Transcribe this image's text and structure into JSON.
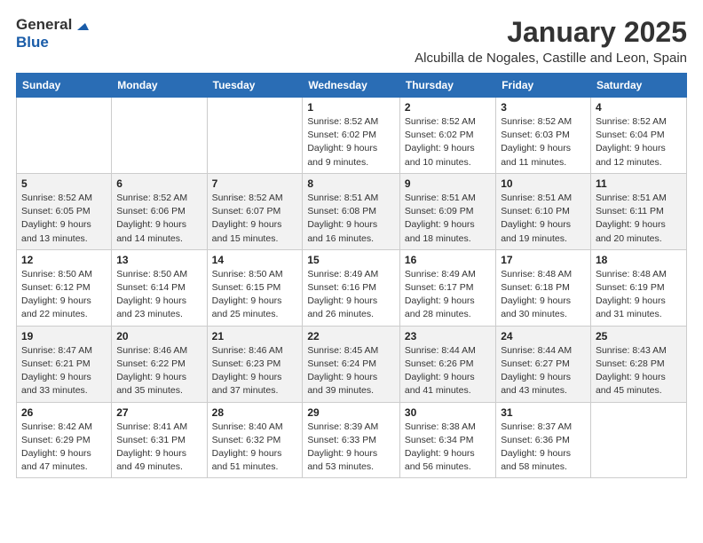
{
  "logo": {
    "general": "General",
    "blue": "Blue"
  },
  "header": {
    "title": "January 2025",
    "subtitle": "Alcubilla de Nogales, Castille and Leon, Spain"
  },
  "weekdays": [
    "Sunday",
    "Monday",
    "Tuesday",
    "Wednesday",
    "Thursday",
    "Friday",
    "Saturday"
  ],
  "weeks": [
    [
      {
        "day": "",
        "detail": ""
      },
      {
        "day": "",
        "detail": ""
      },
      {
        "day": "",
        "detail": ""
      },
      {
        "day": "1",
        "detail": "Sunrise: 8:52 AM\nSunset: 6:02 PM\nDaylight: 9 hours and 9 minutes."
      },
      {
        "day": "2",
        "detail": "Sunrise: 8:52 AM\nSunset: 6:02 PM\nDaylight: 9 hours and 10 minutes."
      },
      {
        "day": "3",
        "detail": "Sunrise: 8:52 AM\nSunset: 6:03 PM\nDaylight: 9 hours and 11 minutes."
      },
      {
        "day": "4",
        "detail": "Sunrise: 8:52 AM\nSunset: 6:04 PM\nDaylight: 9 hours and 12 minutes."
      }
    ],
    [
      {
        "day": "5",
        "detail": "Sunrise: 8:52 AM\nSunset: 6:05 PM\nDaylight: 9 hours and 13 minutes."
      },
      {
        "day": "6",
        "detail": "Sunrise: 8:52 AM\nSunset: 6:06 PM\nDaylight: 9 hours and 14 minutes."
      },
      {
        "day": "7",
        "detail": "Sunrise: 8:52 AM\nSunset: 6:07 PM\nDaylight: 9 hours and 15 minutes."
      },
      {
        "day": "8",
        "detail": "Sunrise: 8:51 AM\nSunset: 6:08 PM\nDaylight: 9 hours and 16 minutes."
      },
      {
        "day": "9",
        "detail": "Sunrise: 8:51 AM\nSunset: 6:09 PM\nDaylight: 9 hours and 18 minutes."
      },
      {
        "day": "10",
        "detail": "Sunrise: 8:51 AM\nSunset: 6:10 PM\nDaylight: 9 hours and 19 minutes."
      },
      {
        "day": "11",
        "detail": "Sunrise: 8:51 AM\nSunset: 6:11 PM\nDaylight: 9 hours and 20 minutes."
      }
    ],
    [
      {
        "day": "12",
        "detail": "Sunrise: 8:50 AM\nSunset: 6:12 PM\nDaylight: 9 hours and 22 minutes."
      },
      {
        "day": "13",
        "detail": "Sunrise: 8:50 AM\nSunset: 6:14 PM\nDaylight: 9 hours and 23 minutes."
      },
      {
        "day": "14",
        "detail": "Sunrise: 8:50 AM\nSunset: 6:15 PM\nDaylight: 9 hours and 25 minutes."
      },
      {
        "day": "15",
        "detail": "Sunrise: 8:49 AM\nSunset: 6:16 PM\nDaylight: 9 hours and 26 minutes."
      },
      {
        "day": "16",
        "detail": "Sunrise: 8:49 AM\nSunset: 6:17 PM\nDaylight: 9 hours and 28 minutes."
      },
      {
        "day": "17",
        "detail": "Sunrise: 8:48 AM\nSunset: 6:18 PM\nDaylight: 9 hours and 30 minutes."
      },
      {
        "day": "18",
        "detail": "Sunrise: 8:48 AM\nSunset: 6:19 PM\nDaylight: 9 hours and 31 minutes."
      }
    ],
    [
      {
        "day": "19",
        "detail": "Sunrise: 8:47 AM\nSunset: 6:21 PM\nDaylight: 9 hours and 33 minutes."
      },
      {
        "day": "20",
        "detail": "Sunrise: 8:46 AM\nSunset: 6:22 PM\nDaylight: 9 hours and 35 minutes."
      },
      {
        "day": "21",
        "detail": "Sunrise: 8:46 AM\nSunset: 6:23 PM\nDaylight: 9 hours and 37 minutes."
      },
      {
        "day": "22",
        "detail": "Sunrise: 8:45 AM\nSunset: 6:24 PM\nDaylight: 9 hours and 39 minutes."
      },
      {
        "day": "23",
        "detail": "Sunrise: 8:44 AM\nSunset: 6:26 PM\nDaylight: 9 hours and 41 minutes."
      },
      {
        "day": "24",
        "detail": "Sunrise: 8:44 AM\nSunset: 6:27 PM\nDaylight: 9 hours and 43 minutes."
      },
      {
        "day": "25",
        "detail": "Sunrise: 8:43 AM\nSunset: 6:28 PM\nDaylight: 9 hours and 45 minutes."
      }
    ],
    [
      {
        "day": "26",
        "detail": "Sunrise: 8:42 AM\nSunset: 6:29 PM\nDaylight: 9 hours and 47 minutes."
      },
      {
        "day": "27",
        "detail": "Sunrise: 8:41 AM\nSunset: 6:31 PM\nDaylight: 9 hours and 49 minutes."
      },
      {
        "day": "28",
        "detail": "Sunrise: 8:40 AM\nSunset: 6:32 PM\nDaylight: 9 hours and 51 minutes."
      },
      {
        "day": "29",
        "detail": "Sunrise: 8:39 AM\nSunset: 6:33 PM\nDaylight: 9 hours and 53 minutes."
      },
      {
        "day": "30",
        "detail": "Sunrise: 8:38 AM\nSunset: 6:34 PM\nDaylight: 9 hours and 56 minutes."
      },
      {
        "day": "31",
        "detail": "Sunrise: 8:37 AM\nSunset: 6:36 PM\nDaylight: 9 hours and 58 minutes."
      },
      {
        "day": "",
        "detail": ""
      }
    ]
  ]
}
